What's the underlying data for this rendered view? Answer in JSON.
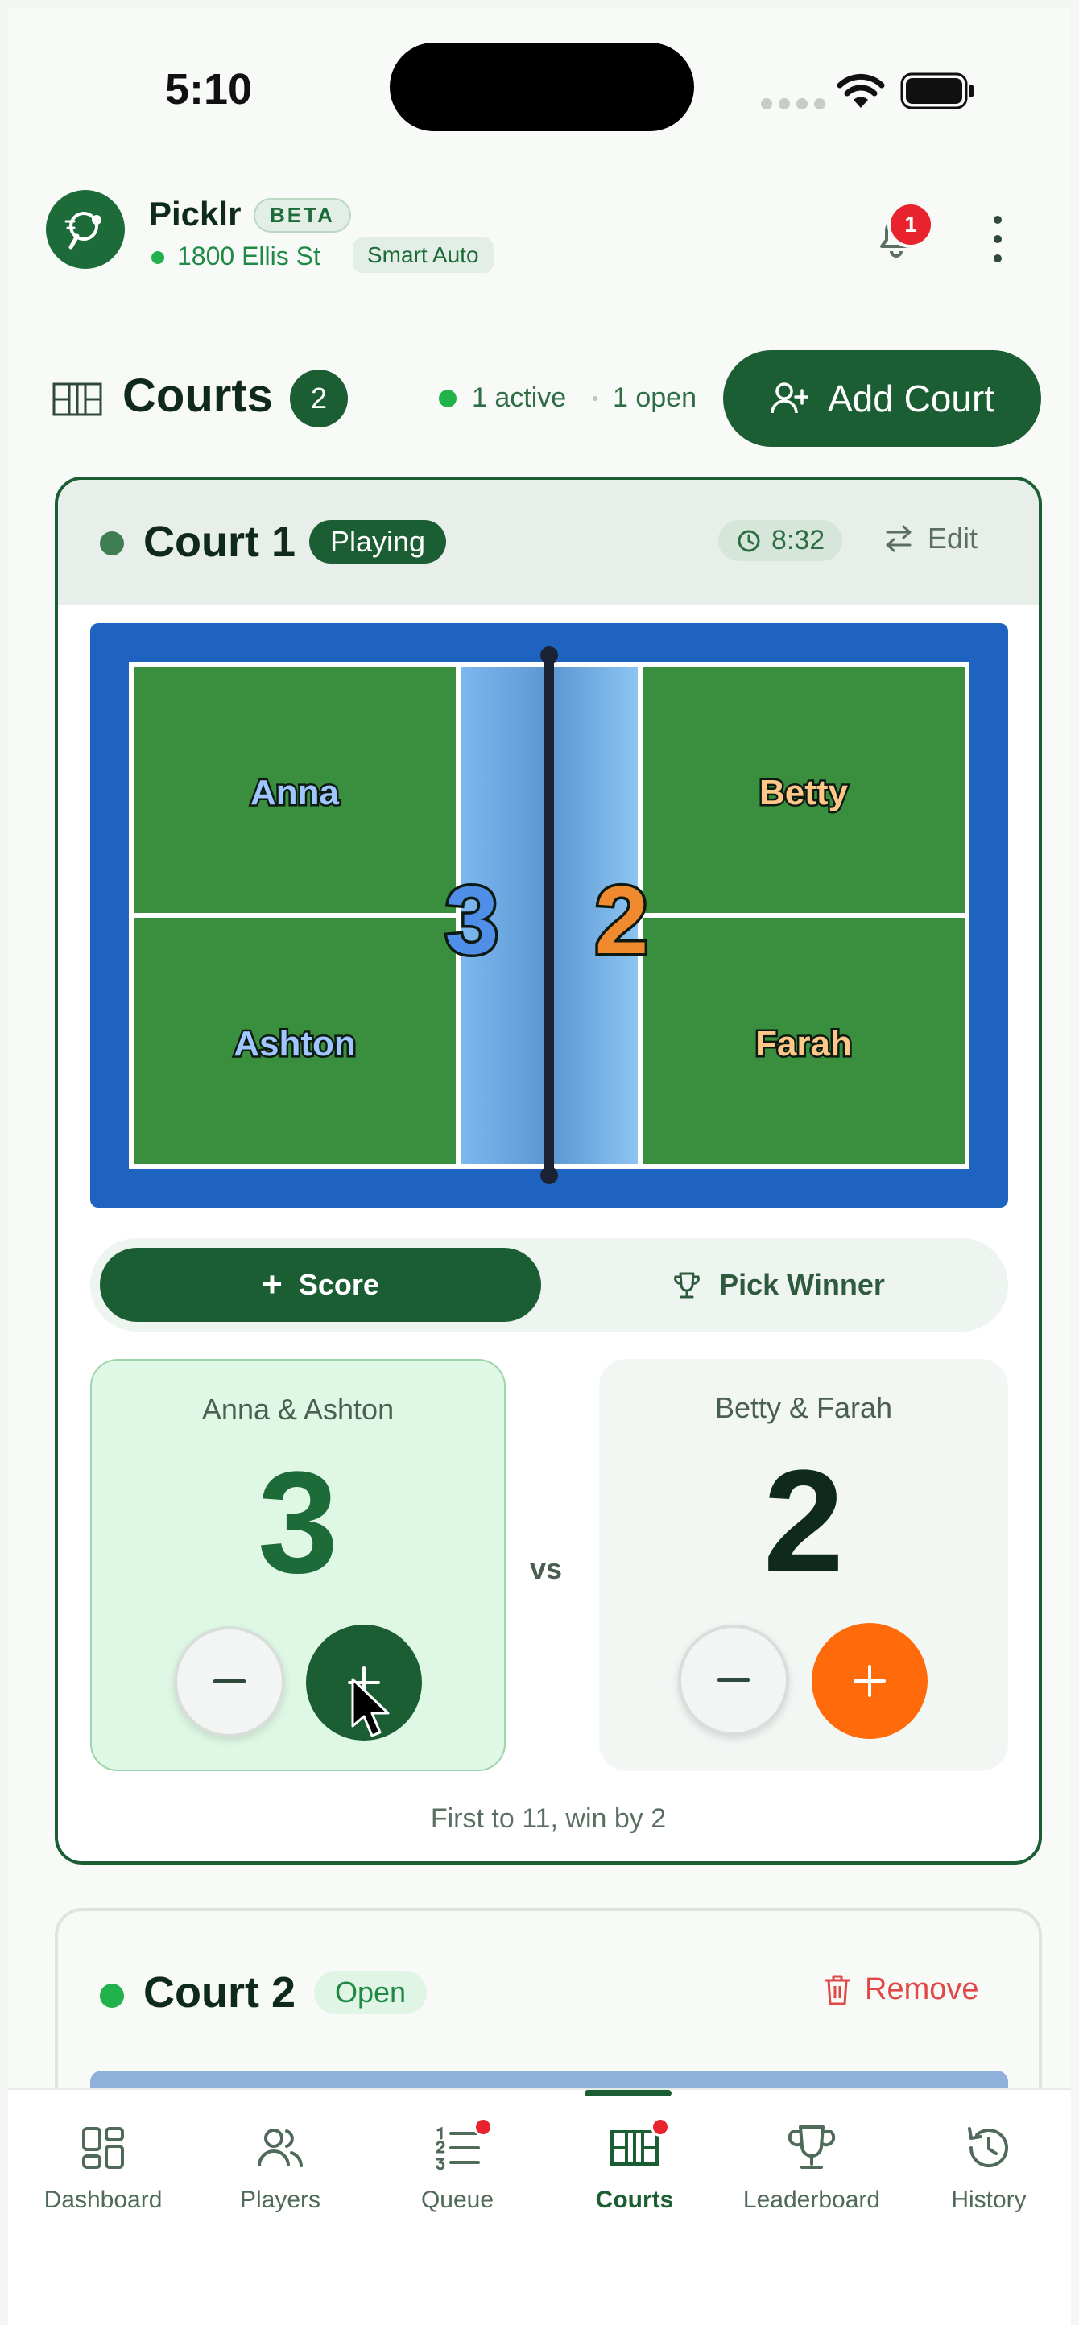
{
  "status_bar": {
    "time": "5:10"
  },
  "header": {
    "app_name": "Picklr",
    "beta_label": "BETA",
    "location": "1800 Ellis St",
    "mode_badge": "Smart Auto",
    "notification_count": "1"
  },
  "courts_section": {
    "title": "Courts",
    "count": "2",
    "active_text": "1 active",
    "open_text": "1 open",
    "add_button": "Add Court"
  },
  "court1": {
    "title": "Court 1",
    "status": "Playing",
    "timer": "8:32",
    "edit_label": "Edit",
    "players": {
      "top_left": "Anna",
      "bottom_left": "Ashton",
      "top_right": "Betty",
      "bottom_right": "Farah"
    },
    "court_score_left": "3",
    "court_score_right": "2",
    "tab_score": "Score",
    "tab_winner": "Pick Winner",
    "team_a": {
      "name": "Anna & Ashton",
      "score": "3"
    },
    "team_b": {
      "name": "Betty & Farah",
      "score": "2"
    },
    "vs": "vs",
    "rule": "First to 11, win by 2"
  },
  "court2": {
    "title": "Court 2",
    "status": "Open",
    "remove_label": "Remove"
  },
  "nav": {
    "items": [
      {
        "label": "Dashboard"
      },
      {
        "label": "Players"
      },
      {
        "label": "Queue"
      },
      {
        "label": "Courts"
      },
      {
        "label": "Leaderboard"
      },
      {
        "label": "History"
      }
    ],
    "active": "Courts"
  },
  "colors": {
    "brand_green": "#1c5e34",
    "accent_orange": "#ff6a0a",
    "court_blue": "#1d63bf",
    "court_green": "#3a8f3e",
    "alert_red": "#e8232d"
  }
}
